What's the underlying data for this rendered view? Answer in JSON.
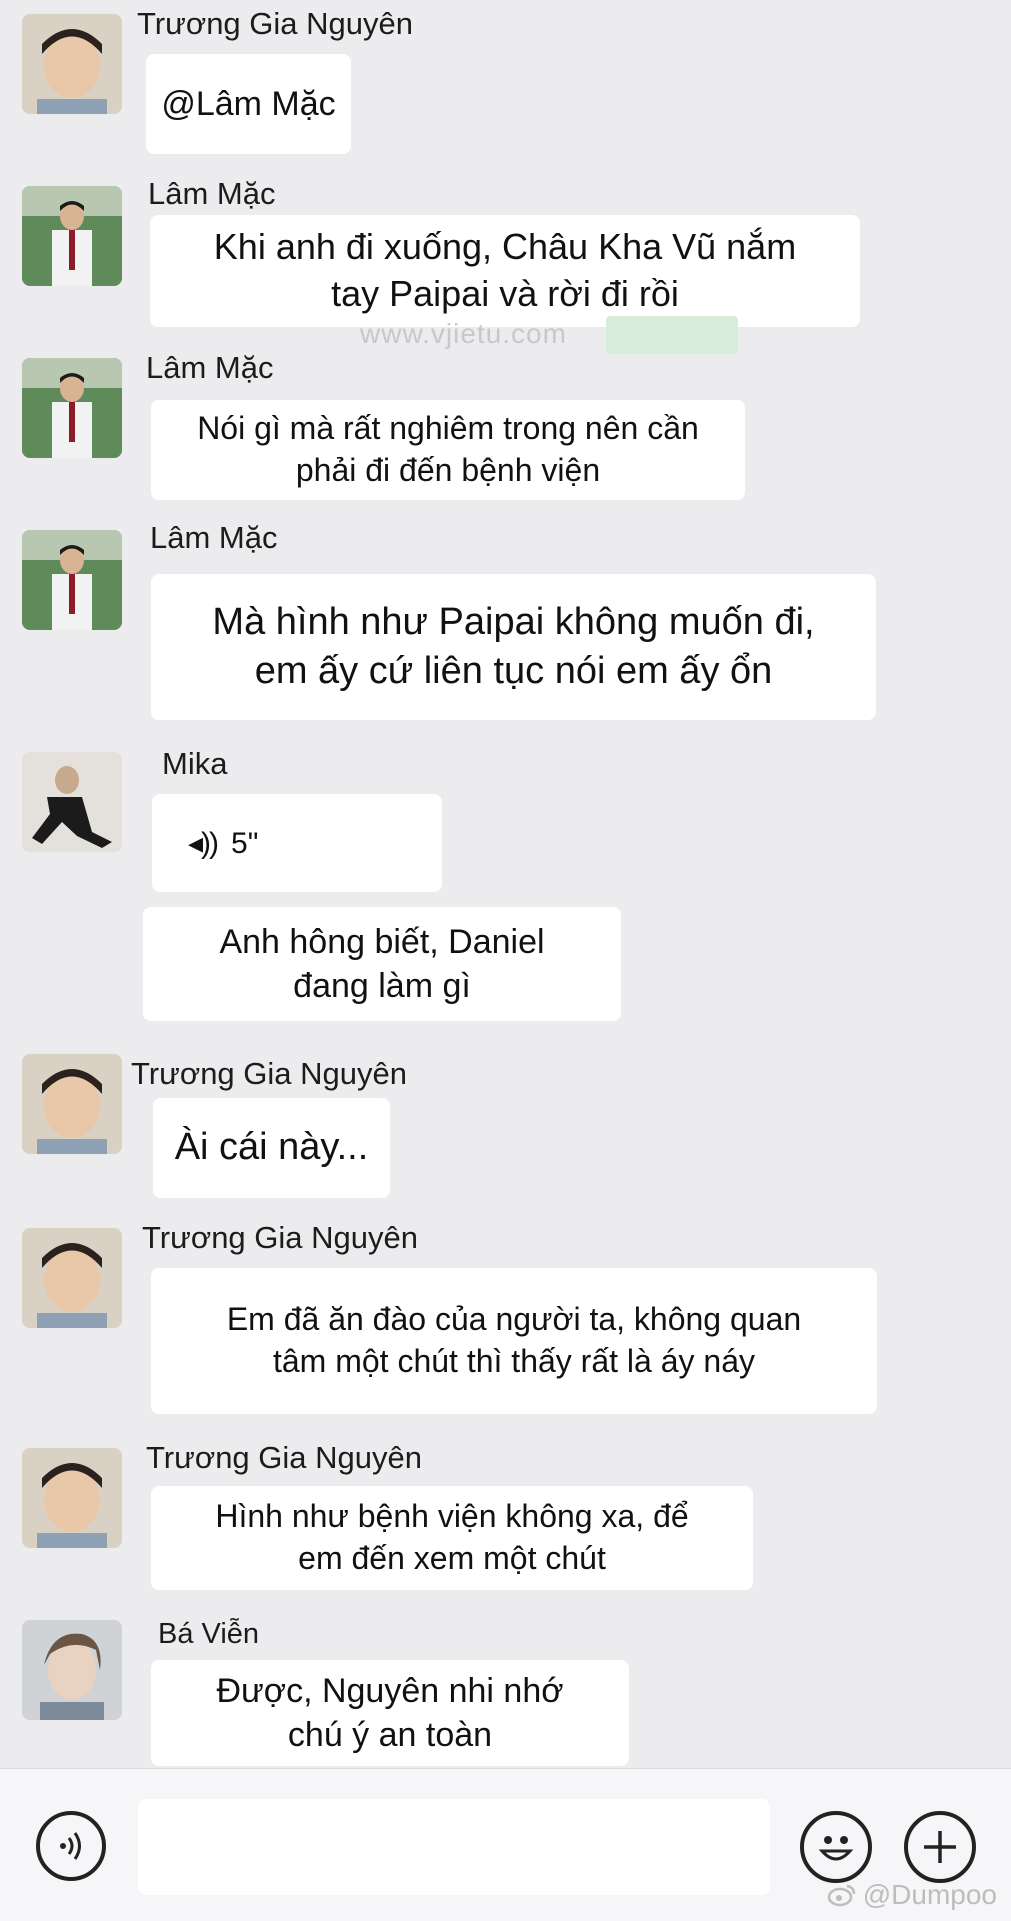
{
  "messages": [
    {
      "sender": "Trương Gia Nguyên",
      "text": "@Lâm Mặc",
      "avatar": "nguyen-avatar"
    },
    {
      "sender": "Lâm Mặc",
      "lines": [
        "Khi anh đi xuống, Châu Kha Vũ nắm",
        "tay Paipai và rời đi rồi"
      ],
      "avatar": "lam-mac-avatar"
    },
    {
      "sender": "Lâm Mặc",
      "lines": [
        "Nói gì mà rất nghiêm trong nên cần",
        "phải đi đến bệnh viện"
      ],
      "avatar": "lam-mac-avatar"
    },
    {
      "sender": "Lâm Mặc",
      "lines": [
        "Mà hình như Paipai không muốn đi,",
        "em ấy cứ liên tục nói em ấy ổn"
      ],
      "avatar": "lam-mac-avatar"
    },
    {
      "sender": "Mika",
      "voice": {
        "icon": "voice-wave-icon",
        "duration": "5\""
      },
      "lines": [
        "Anh hông biết, Daniel",
        "đang làm gì"
      ],
      "avatar": "mika-avatar"
    },
    {
      "sender": "Trương Gia Nguyên",
      "text": "Ài cái này...",
      "avatar": "nguyen-avatar"
    },
    {
      "sender": "Trương Gia Nguyên",
      "lines": [
        "Em đã ăn đào của người ta, không quan",
        "tâm một chút thì thấy rất là áy náy"
      ],
      "avatar": "nguyen-avatar"
    },
    {
      "sender": "Trương Gia Nguyên",
      "lines": [
        "Hình như bệnh viện không xa, để",
        "em đến xem một chút"
      ],
      "avatar": "nguyen-avatar"
    },
    {
      "sender": "Bá Viễn",
      "lines": [
        "Được, Nguyên nhi nhớ",
        "chú ý an toàn"
      ],
      "avatar": "ba-vien-avatar"
    }
  ],
  "watermark": "www.vjietu.com",
  "credit": {
    "icon": "weibo-icon",
    "text": "@Dumpoo"
  },
  "input_bar": {
    "voice_icon": "voice-input-icon",
    "emoji_icon": "emoji-icon",
    "plus_icon": "plus-icon"
  },
  "colors": {
    "background": "#ececee",
    "bubble": "#ffffff"
  }
}
